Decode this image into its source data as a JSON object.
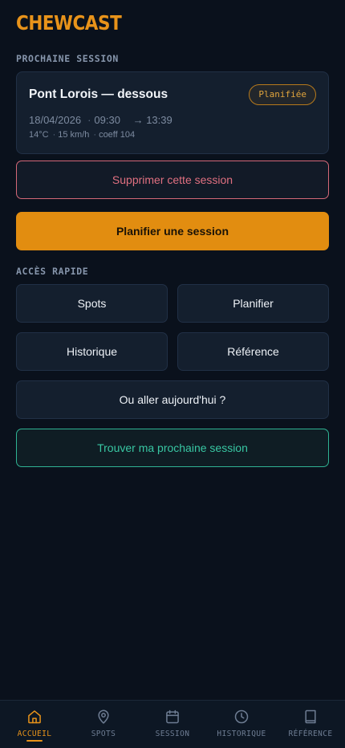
{
  "brand": "CHEWCAST",
  "next_session": {
    "section_label": "PROCHAINE SESSION",
    "title": "Pont Lorois — dessous",
    "status": "Planifiée",
    "date": "18/04/2026",
    "start": "09:30",
    "end": "→ 13:39",
    "temperature": "14°C",
    "wind": "15 km/h",
    "coefficient": "coeff 104",
    "delete_label": "Supprimer cette session"
  },
  "plan_button": "Planifier une session",
  "quick_access": {
    "section_label": "ACCÈS RAPIDE",
    "spots": "Spots",
    "planifier": "Planifier",
    "historique": "Historique",
    "reference": "Référence",
    "where_today": "Ou aller aujourd'hui ?",
    "find_next": "Trouver ma prochaine session"
  },
  "nav": {
    "home": "ACCUEIL",
    "spots": "SPOTS",
    "session": "SESSION",
    "history": "HISTORIQUE",
    "reference": "RÉFÉRENCE",
    "active": "home"
  },
  "colors": {
    "accent": "#e8931a",
    "danger": "#e07080",
    "teal": "#38c7a3",
    "background": "#0a111c",
    "card": "#141f2e"
  }
}
